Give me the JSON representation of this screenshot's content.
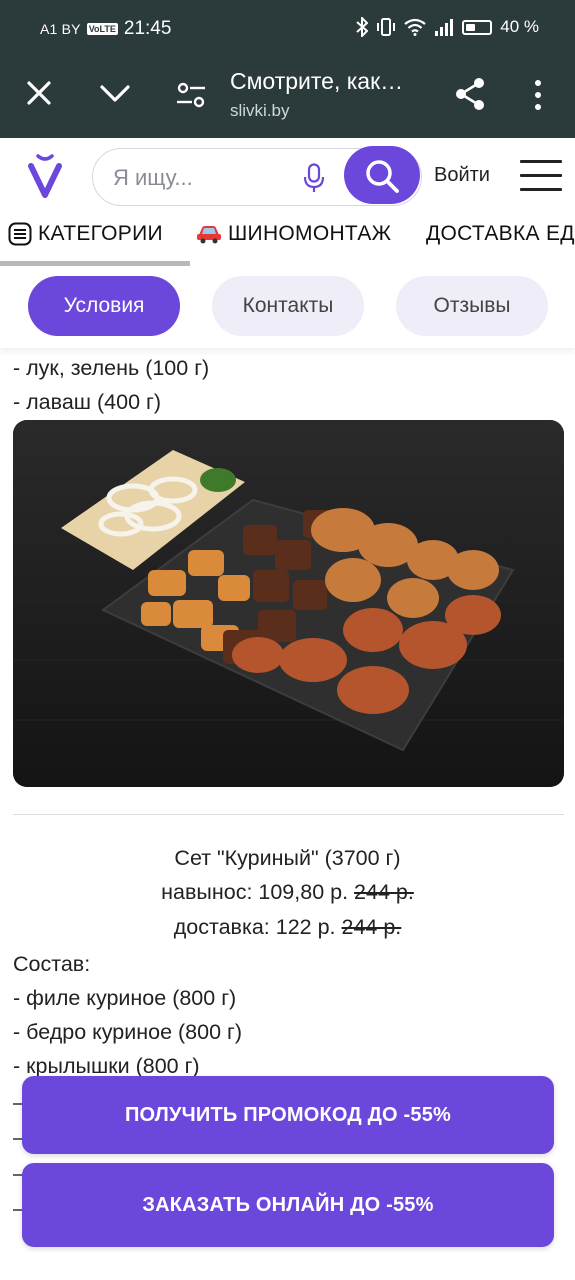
{
  "status_bar": {
    "carrier": "A1 BY",
    "volte": "VoLTE",
    "time": "21:45",
    "battery": "40 %"
  },
  "custom_tab": {
    "title": "Смотрите, как…",
    "url": "slivki.by"
  },
  "header": {
    "search_placeholder": "Я ищу...",
    "login_label": "Войти"
  },
  "categories": [
    {
      "label": "КАТЕГОРИИ"
    },
    {
      "label": "ШИНОМОНТАЖ"
    },
    {
      "label": "ДОСТАВКА ЕД"
    }
  ],
  "tabs": [
    {
      "label": "Условия"
    },
    {
      "label": "Контакты"
    },
    {
      "label": "Отзывы"
    }
  ],
  "content": {
    "prev_items": [
      "- лук, зелень (100 г)",
      "- лаваш (400 г)"
    ],
    "set_title": "Сет \"Куриный\" (3700 г)",
    "takeaway_label": "навынос: 109,80 р.",
    "takeaway_old": "244 р.",
    "delivery_label": "доставка: 122 р.",
    "delivery_old": "244 р.",
    "composition_label": "Состав:",
    "items": [
      "- филе куриное (800 г)",
      "- бедро куриное (800 г)",
      "- крылышки (800 г)"
    ]
  },
  "cta": {
    "promo_label": "ПОЛУЧИТЬ ПРОМОКОД ДО -55%",
    "order_label": "ЗАКАЗАТЬ ОНЛАЙН ДО -55%"
  },
  "colors": {
    "accent": "#6b47dc",
    "chrome": "#2b3a3a",
    "pill_inactive": "#eeedf8"
  }
}
